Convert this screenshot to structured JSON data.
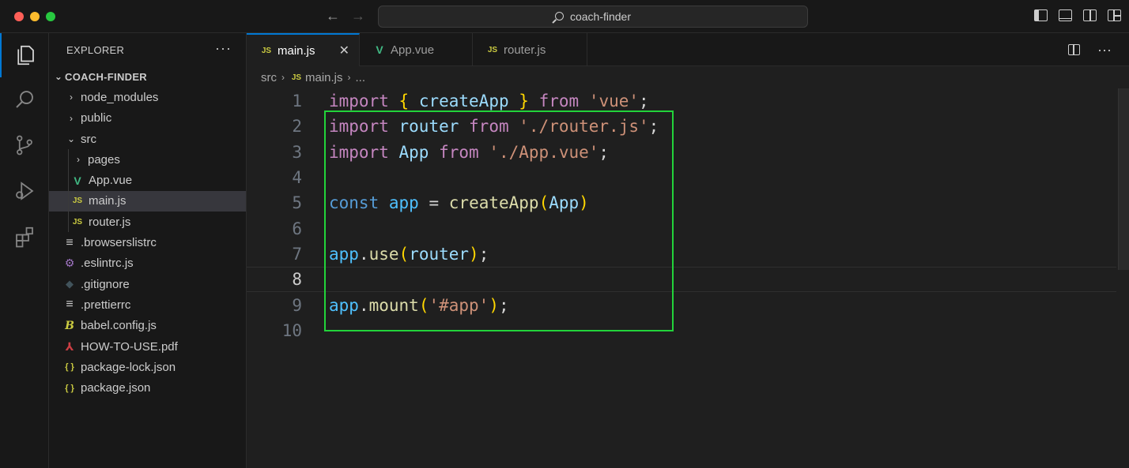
{
  "window": {
    "search_label": "coach-finder"
  },
  "sidebar": {
    "header": "EXPLORER",
    "more": "···",
    "root": "COACH-FINDER",
    "items": [
      {
        "label": "node_modules",
        "chevron": "›"
      },
      {
        "label": "public",
        "chevron": "›"
      },
      {
        "label": "src",
        "chevron": "⌄"
      },
      {
        "label": "pages",
        "chevron": "›"
      },
      {
        "label": "App.vue",
        "icon": "V"
      },
      {
        "label": "main.js",
        "icon": "JS"
      },
      {
        "label": "router.js",
        "icon": "JS"
      },
      {
        "label": ".browserslistrc",
        "icon": "≡"
      },
      {
        "label": ".eslintrc.js",
        "icon": "⚙"
      },
      {
        "label": ".gitignore",
        "icon": "◆"
      },
      {
        "label": ".prettierrc",
        "icon": "≡"
      },
      {
        "label": "babel.config.js",
        "icon": "B"
      },
      {
        "label": "HOW-TO-USE.pdf",
        "icon": "⅄"
      },
      {
        "label": "package-lock.json",
        "icon": "{ }"
      },
      {
        "label": "package.json",
        "icon": "{ }"
      }
    ]
  },
  "tabs": [
    {
      "label": "main.js",
      "icon": "JS",
      "close": "✕"
    },
    {
      "label": "App.vue",
      "icon": "V"
    },
    {
      "label": "router.js",
      "icon": "JS"
    }
  ],
  "breadcrumb": {
    "parts": [
      "src",
      "main.js",
      "..."
    ],
    "file_icon": "JS",
    "sep": "›"
  },
  "code": {
    "line_numbers": [
      "1",
      "2",
      "3",
      "4",
      "5",
      "6",
      "7",
      "8",
      "9",
      "10"
    ],
    "current_line": "8",
    "tokens": {
      "import": "import",
      "from": "from",
      "const": "const",
      "createApp": "createApp",
      "router": "router",
      "App": "App",
      "app": "app",
      "use": "use",
      "mount": "mount",
      "vue_str": "'vue'",
      "router_str": "'./router.js'",
      "app_vue_str": "'./App.vue'",
      "app_id_str": "'#app'"
    }
  },
  "colors": {
    "highlight_box": "#22d33a",
    "accent": "#0078d4"
  }
}
